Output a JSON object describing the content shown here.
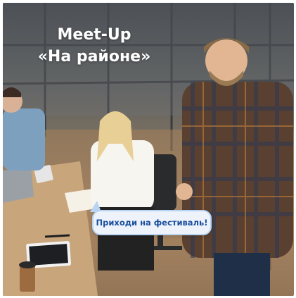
{
  "poster": {
    "title_line1": "Meet-Up",
    "title_line2": "«На районе»",
    "speech_bubble_text": "Приходи на фестиваль!"
  },
  "colors": {
    "title_text": "#ffffff",
    "bubble_background": "#eef3fb",
    "bubble_border": "#b8d4f2",
    "bubble_text": "#1a4f9e"
  }
}
